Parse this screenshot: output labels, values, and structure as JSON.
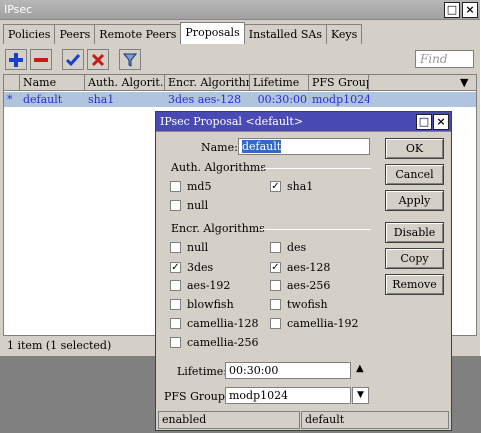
{
  "window": {
    "title": "IPsec"
  },
  "tabs": [
    "Policies",
    "Peers",
    "Remote Peers",
    "Proposals",
    "Installed SAs",
    "Keys"
  ],
  "toolbar": {
    "find_placeholder": "Find"
  },
  "table": {
    "columns": [
      "Name",
      "Auth. Algorit...",
      "Encr. Algorithms",
      "Lifetime",
      "PFS Group"
    ],
    "rows": [
      {
        "marker": "*",
        "name": "default",
        "auth": "sha1",
        "encr": "3des aes-128",
        "lifetime": "00:30:00",
        "pfs": "modp1024"
      }
    ]
  },
  "status": {
    "text": "1 item (1 selected)"
  },
  "dialog": {
    "title": "IPsec Proposal <default>",
    "name_label": "Name:",
    "name_value": "default",
    "auth_group": "Auth. Algorithms",
    "auth": {
      "md5": "md5",
      "sha1": "sha1",
      "null": "null"
    },
    "encr_group": "Encr. Algorithms",
    "encr": {
      "null": "null",
      "des": "des",
      "3des": "3des",
      "aes128": "aes-128",
      "aes192": "aes-192",
      "aes256": "aes-256",
      "blowfish": "blowfish",
      "twofish": "twofish",
      "camellia128": "camellia-128",
      "camellia192": "camellia-192",
      "camellia256": "camellia-256"
    },
    "lifetime_label": "Lifetime:",
    "lifetime_value": "00:30:00",
    "pfs_label": "PFS Group:",
    "pfs_value": "modp1024",
    "buttons": {
      "ok": "OK",
      "cancel": "Cancel",
      "apply": "Apply",
      "disable": "Disable",
      "copy": "Copy",
      "remove": "Remove"
    },
    "status_left": "enabled",
    "status_right": "default"
  },
  "colors": {
    "dialog_title": "#4a4ab4",
    "selected_row": "#b0c4de",
    "row_text": "#2b2bd8",
    "add_icon": "#1a3fc8",
    "remove_icon": "#c81a1a"
  }
}
